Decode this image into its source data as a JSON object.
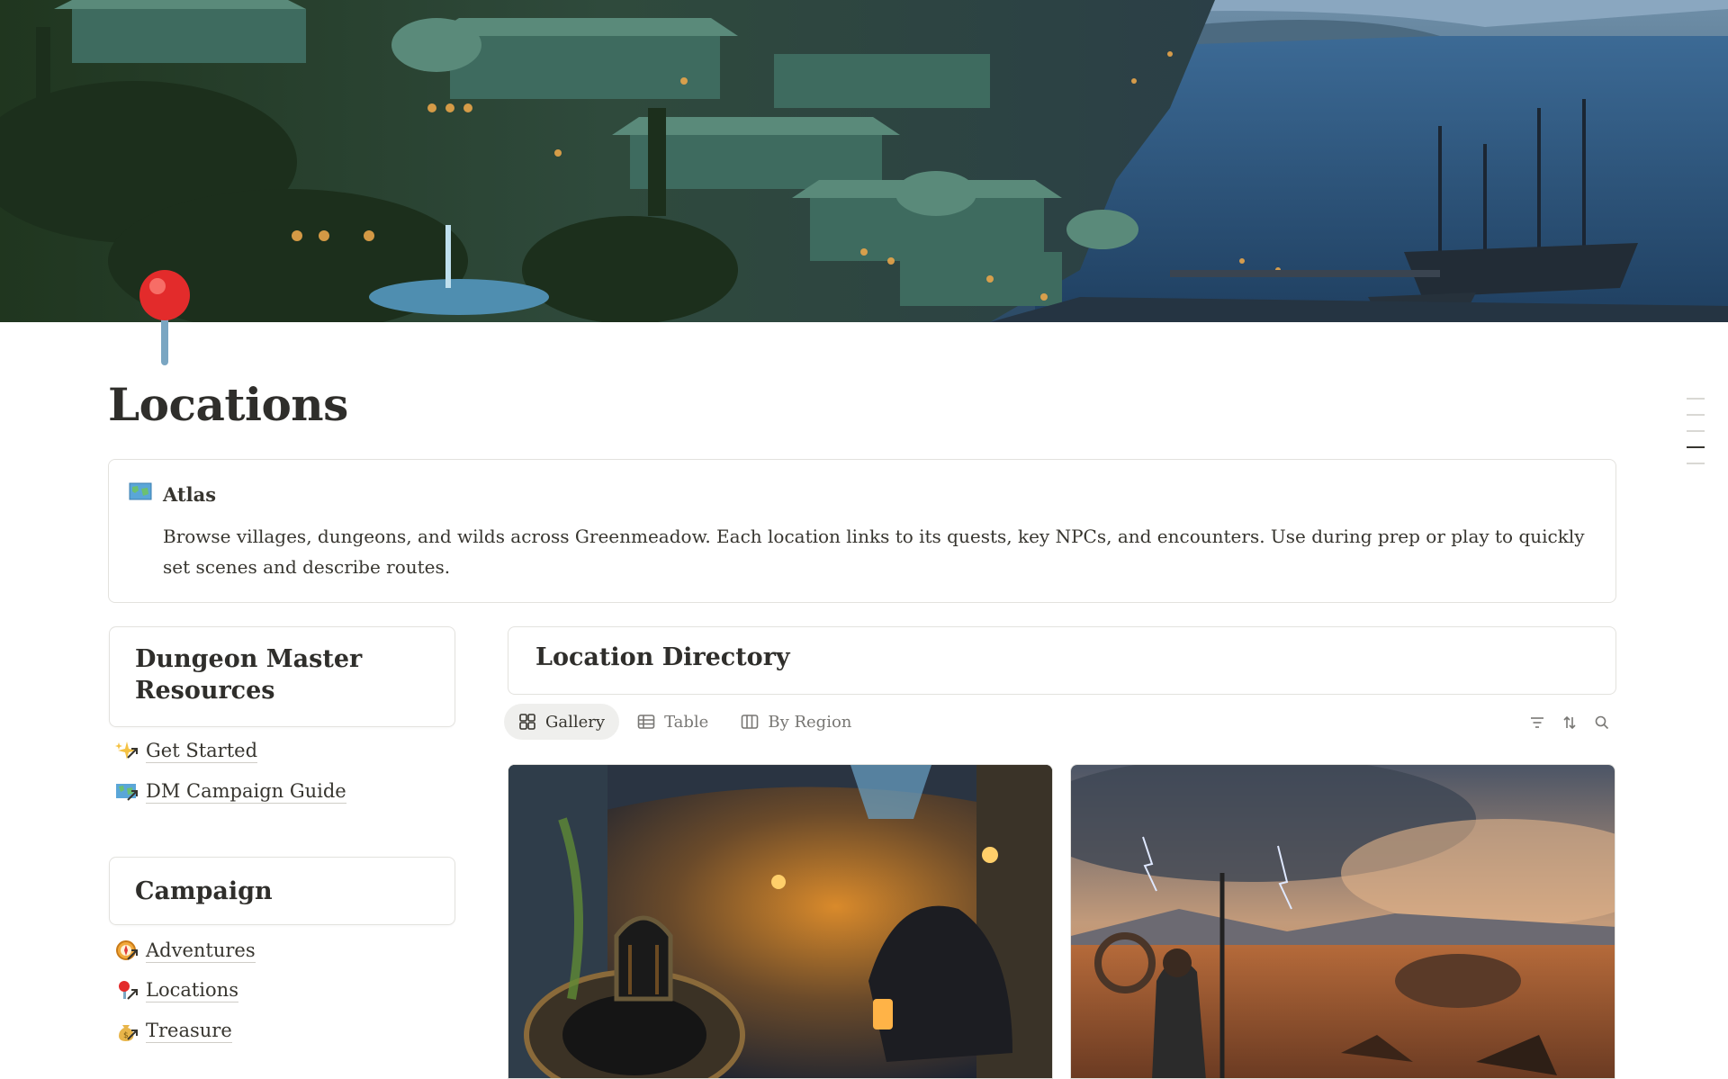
{
  "cover": {
    "name": "coastal-city-cover"
  },
  "page": {
    "icon": "pushpin-icon",
    "title": "Locations"
  },
  "callout": {
    "icon": "world-map-icon",
    "title": "Atlas",
    "body": "Browse villages, dungeons, and wilds across Greenmeadow. Each location links to its quests, key NPCs, and encounters. Use during prep or play to quickly set scenes and describe routes."
  },
  "sidebar": {
    "resources_title": "Dungeon Master Resources",
    "resources_links": [
      {
        "label": "Get Started",
        "icon": "sparkles-icon"
      },
      {
        "label": "DM Campaign Guide",
        "icon": "world-map-icon"
      }
    ],
    "campaign_title": "Campaign",
    "campaign_links": [
      {
        "label": "Adventures",
        "icon": "compass-icon"
      },
      {
        "label": "Locations",
        "icon": "pushpin-icon"
      },
      {
        "label": "Treasure",
        "icon": "money-bag-icon"
      }
    ]
  },
  "directory": {
    "title": "Location Directory",
    "tabs": [
      {
        "label": "Gallery",
        "icon": "gallery-icon",
        "active": true
      },
      {
        "label": "Table",
        "icon": "table-icon",
        "active": false
      },
      {
        "label": "By Region",
        "icon": "board-icon",
        "active": false
      }
    ],
    "tools": [
      "filter-icon",
      "sort-icon",
      "search-icon"
    ],
    "cards": [
      {
        "image": "sewer-tunnel-lantern"
      },
      {
        "image": "stormy-wasteland-warrior"
      }
    ]
  },
  "colors": {
    "text": "#37352f",
    "border": "#e3e2de",
    "muted": "#787774",
    "active_tab": "#efefed"
  }
}
